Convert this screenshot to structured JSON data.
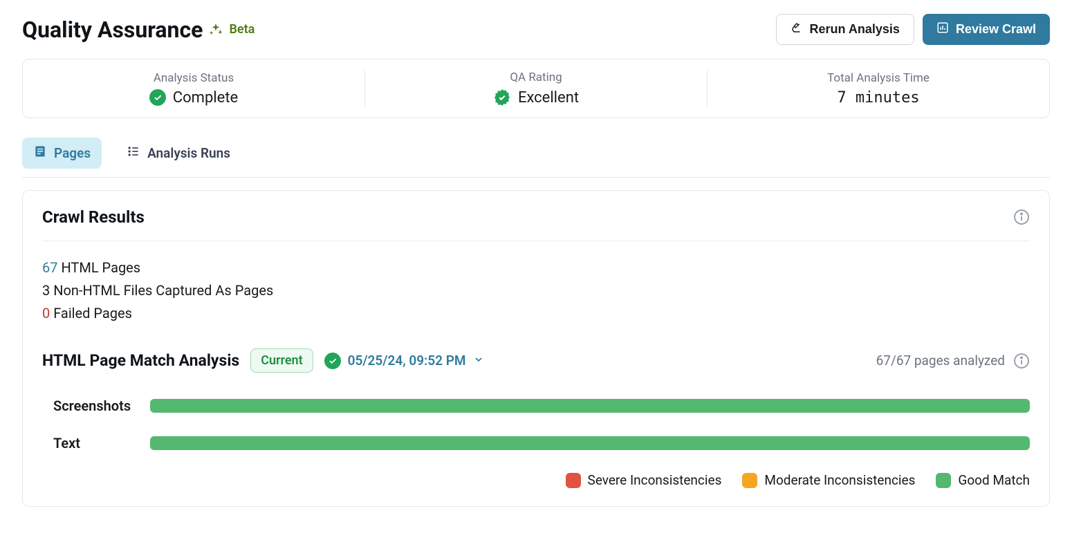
{
  "header": {
    "title": "Quality Assurance",
    "badge": "Beta",
    "rerun_label": "Rerun Analysis",
    "review_label": "Review Crawl"
  },
  "status": {
    "analysis_label": "Analysis Status",
    "analysis_value": "Complete",
    "rating_label": "QA Rating",
    "rating_value": "Excellent",
    "time_label": "Total Analysis Time",
    "time_value": "7 minutes"
  },
  "tabs": {
    "pages": "Pages",
    "runs": "Analysis Runs"
  },
  "crawl": {
    "title": "Crawl Results",
    "html_count": "67",
    "html_label": " HTML Pages",
    "nonhtml_count": "3",
    "nonhtml_label": " Non-HTML Files Captured As Pages",
    "failed_count": "0",
    "failed_label": " Failed Pages"
  },
  "analysis": {
    "title": "HTML Page Match Analysis",
    "current_label": "Current",
    "timestamp": "05/25/24, 09:52 PM",
    "analyzed_text": "67/67 pages analyzed"
  },
  "bars": {
    "screenshots": "Screenshots",
    "text": "Text"
  },
  "legend": {
    "severe": "Severe Inconsistencies",
    "moderate": "Moderate Inconsistencies",
    "good": "Good Match"
  },
  "chart_data": {
    "type": "bar",
    "categories": [
      "Screenshots",
      "Text"
    ],
    "series": [
      {
        "name": "Severe Inconsistencies",
        "values": [
          0,
          0
        ]
      },
      {
        "name": "Moderate Inconsistencies",
        "values": [
          0,
          0
        ]
      },
      {
        "name": "Good Match",
        "values": [
          100,
          100
        ]
      }
    ],
    "xlim": [
      0,
      100
    ],
    "title": "HTML Page Match Analysis"
  }
}
